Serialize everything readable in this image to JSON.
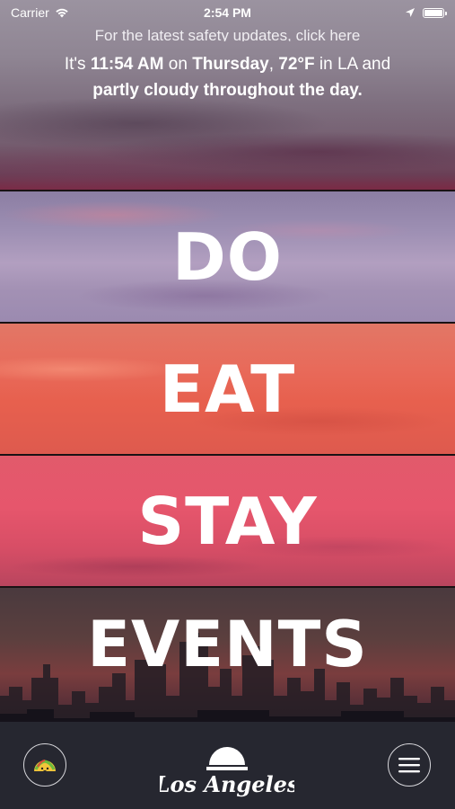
{
  "status_bar": {
    "carrier": "Carrier",
    "time": "2:54 PM"
  },
  "header": {
    "safety_link": "For the latest safety updates, click here",
    "weather": {
      "prefix": "It's ",
      "time": "11:54 AM",
      "on": " on ",
      "day": "Thursday",
      "comma": ", ",
      "temp": "72°F",
      "in": " in LA and ",
      "conditions": "partly cloudy throughout the day."
    }
  },
  "menu": {
    "items": [
      {
        "label": "DO"
      },
      {
        "label": "EAT"
      },
      {
        "label": "STAY"
      },
      {
        "label": "EVENTS"
      }
    ]
  },
  "bottom_bar": {
    "logo_text": "Los Angeles",
    "left_icon": "taco-icon",
    "right_icon": "hamburger-menu-icon"
  }
}
